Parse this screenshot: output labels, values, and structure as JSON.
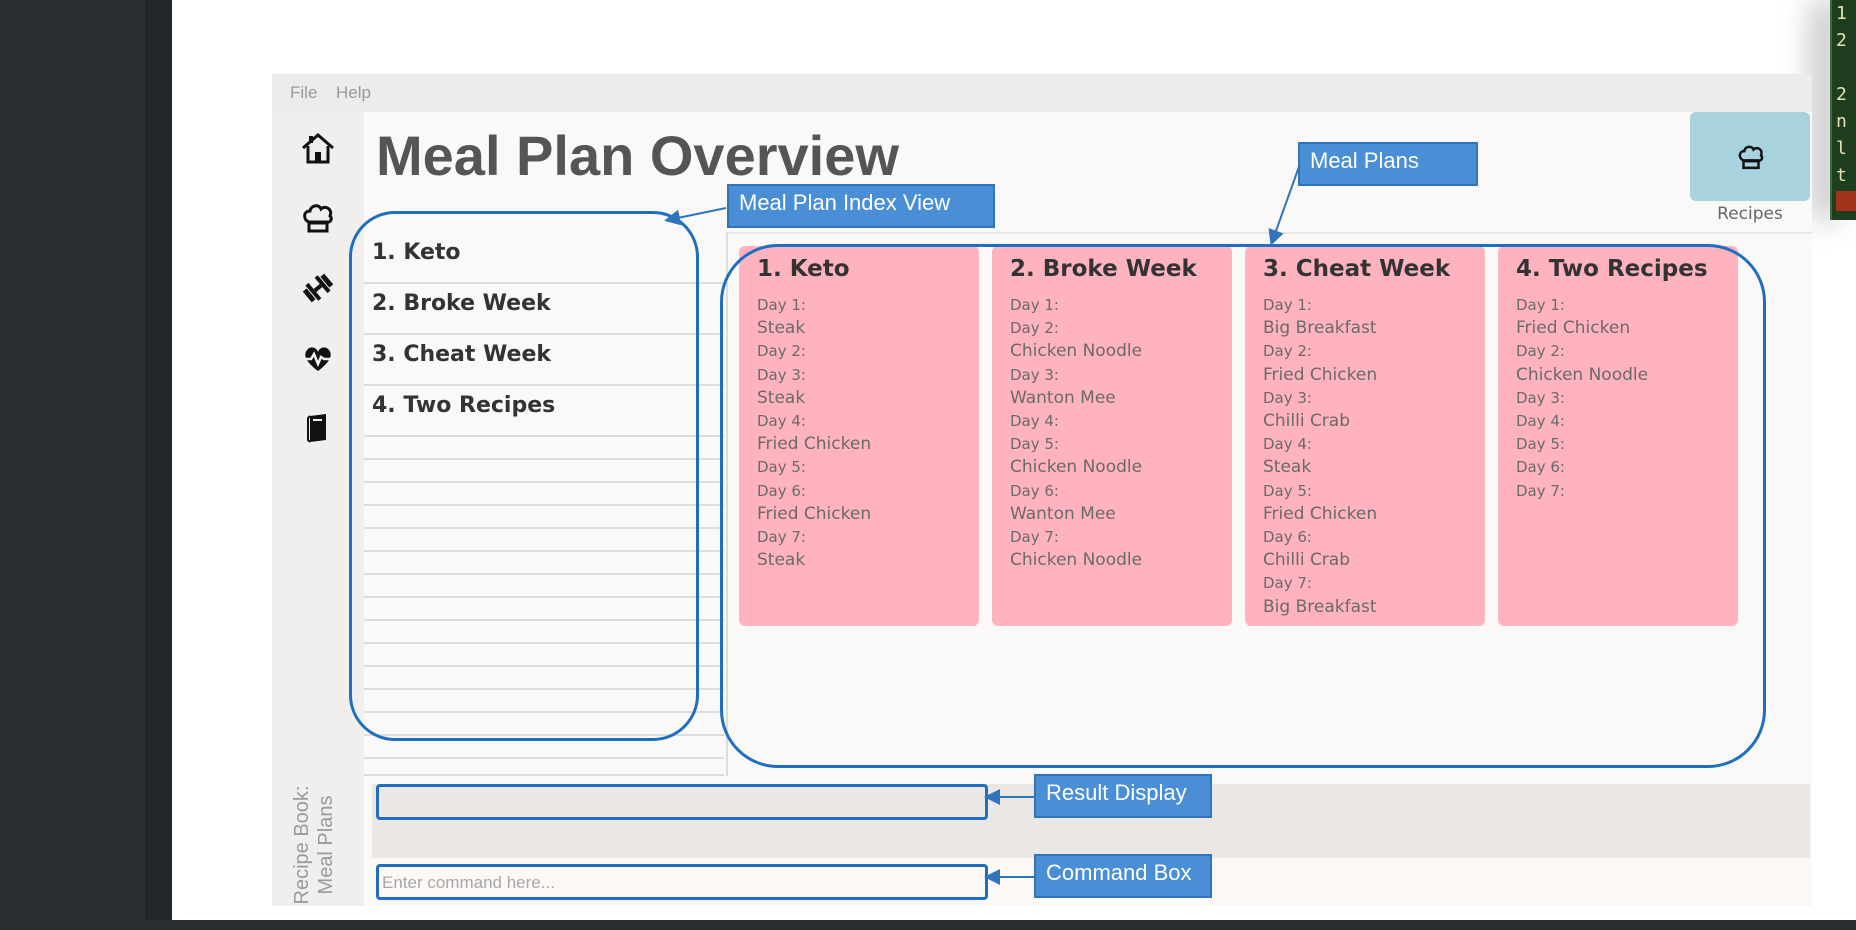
{
  "terminal": {
    "lines": [
      "1",
      "2",
      "",
      "2",
      "n",
      "l",
      "t"
    ]
  },
  "menu": {
    "file": "File",
    "help": "Help"
  },
  "sidebar": {
    "icons": [
      "home-icon",
      "chef-hat-icon",
      "dumbbell-icon",
      "heartbeat-icon",
      "book-icon"
    ],
    "label_line1": "Recipe Book:",
    "label_line2": "Meal Plans"
  },
  "page_title": "Meal Plan Overview",
  "recipes_button": {
    "label": "Recipes",
    "icon": "chef-hat-icon"
  },
  "index_list": [
    "1.  Keto",
    "2.  Broke Week",
    "3.  Cheat Week",
    "4.  Two Recipes"
  ],
  "meal_plans": [
    {
      "title": "1.  Keto",
      "lines": [
        {
          "t": "Day 1:",
          "m": false
        },
        {
          "t": "Steak",
          "m": true
        },
        {
          "t": "Day 2:",
          "m": false
        },
        {
          "t": "Day 3:",
          "m": false
        },
        {
          "t": "Steak",
          "m": true
        },
        {
          "t": "Day 4:",
          "m": false
        },
        {
          "t": "Fried Chicken",
          "m": true
        },
        {
          "t": "Day 5:",
          "m": false
        },
        {
          "t": "Day 6:",
          "m": false
        },
        {
          "t": "Fried Chicken",
          "m": true
        },
        {
          "t": "Day 7:",
          "m": false
        },
        {
          "t": "Steak",
          "m": true
        }
      ]
    },
    {
      "title": "2.  Broke Week",
      "lines": [
        {
          "t": "Day 1:",
          "m": false
        },
        {
          "t": "Day 2:",
          "m": false
        },
        {
          "t": "Chicken Noodle",
          "m": true
        },
        {
          "t": "Day 3:",
          "m": false
        },
        {
          "t": "Wanton Mee",
          "m": true
        },
        {
          "t": "Day 4:",
          "m": false
        },
        {
          "t": "Day 5:",
          "m": false
        },
        {
          "t": "Chicken Noodle",
          "m": true
        },
        {
          "t": "Day 6:",
          "m": false
        },
        {
          "t": "Wanton Mee",
          "m": true
        },
        {
          "t": "Day 7:",
          "m": false
        },
        {
          "t": "Chicken Noodle",
          "m": true
        }
      ]
    },
    {
      "title": "3.  Cheat Week",
      "lines": [
        {
          "t": "Day 1:",
          "m": false
        },
        {
          "t": "Big Breakfast",
          "m": true
        },
        {
          "t": "Day 2:",
          "m": false
        },
        {
          "t": "Fried Chicken",
          "m": true
        },
        {
          "t": "Day 3:",
          "m": false
        },
        {
          "t": "Chilli Crab",
          "m": true
        },
        {
          "t": "Day 4:",
          "m": false
        },
        {
          "t": "Steak",
          "m": true
        },
        {
          "t": "Day 5:",
          "m": false
        },
        {
          "t": "Fried Chicken",
          "m": true
        },
        {
          "t": "Day 6:",
          "m": false
        },
        {
          "t": "Chilli Crab",
          "m": true
        },
        {
          "t": "Day 7:",
          "m": false
        },
        {
          "t": "Big Breakfast",
          "m": true
        }
      ]
    },
    {
      "title": "4.  Two Recipes",
      "lines": [
        {
          "t": "Day 1:",
          "m": false
        },
        {
          "t": "Fried Chicken",
          "m": true
        },
        {
          "t": "Day 2:",
          "m": false
        },
        {
          "t": "Chicken Noodle",
          "m": true
        },
        {
          "t": "Day 3:",
          "m": false
        },
        {
          "t": "Day 4:",
          "m": false
        },
        {
          "t": "Day 5:",
          "m": false
        },
        {
          "t": "Day 6:",
          "m": false
        },
        {
          "t": "Day 7:",
          "m": false
        }
      ]
    }
  ],
  "command_box": {
    "placeholder": "Enter command here..."
  },
  "callouts": {
    "index_view": "Meal Plan Index View",
    "meal_plans": "Meal Plans",
    "result_display": "Result Display",
    "command_box": "Command Box"
  },
  "colors": {
    "card_bg": "#ffb3bf",
    "annotation_blue": "#1f6fc0",
    "callout_fill": "#4a8fd6",
    "recipes_tile": "#a8d3de"
  }
}
